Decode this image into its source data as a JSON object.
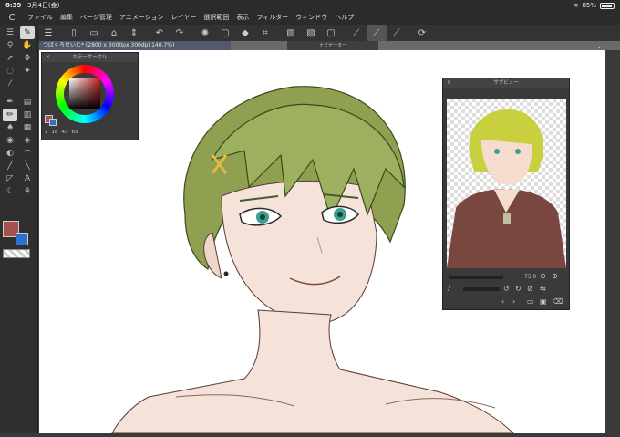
{
  "status": {
    "time": "8:39",
    "date": "3月4日(金)",
    "battery": "85%"
  },
  "menu": {
    "logo": "C",
    "items": [
      "ファイル",
      "編集",
      "ページ管理",
      "アニメーション",
      "レイヤー",
      "選択範囲",
      "表示",
      "フィルター",
      "ウィンドウ",
      "ヘルプ"
    ]
  },
  "document": {
    "tab_label": "つばくろせいじ* (2800 x 3000px 300dpi 140.7%)"
  },
  "navigator": {
    "title": "ナビゲーター"
  },
  "color_panel": {
    "title": "カラーサークル",
    "values": [
      "1",
      "18",
      "43",
      "65"
    ]
  },
  "sub_view": {
    "title": "サブビュー",
    "zoom": "75.0"
  },
  "colors": {
    "main": "#a85050",
    "sub": "#2f6fd0",
    "hair": "#8fa050",
    "skin": "#f5e2d8"
  }
}
